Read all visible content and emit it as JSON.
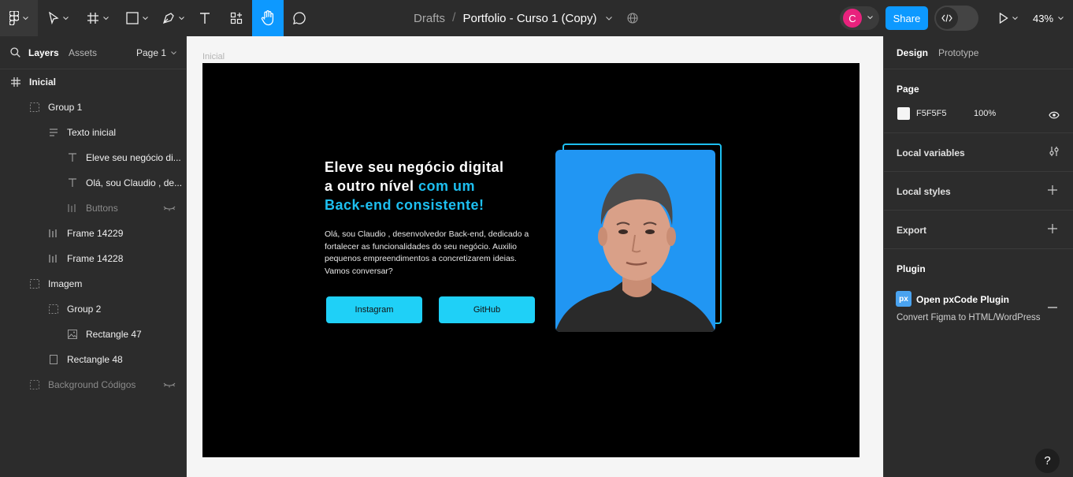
{
  "toolbar": {
    "breadcrumb_folder": "Drafts",
    "breadcrumb_separator": "/",
    "file_name": "Portfolio - Curso 1 (Copy)",
    "avatar_initial": "C",
    "avatar_color": "#e8227d",
    "share_label": "Share",
    "zoom_level": "43%",
    "accent_color": "#0d99ff"
  },
  "left_panel": {
    "tab_layers": "Layers",
    "tab_assets": "Assets",
    "page_selector": "Page 1",
    "layers": [
      {
        "label": "Inicial",
        "icon": "frame-icon",
        "level": 0
      },
      {
        "label": "Group 1",
        "icon": "group-icon",
        "level": 1
      },
      {
        "label": "Texto inicial",
        "icon": "auto-layout-vertical-icon",
        "level": 2
      },
      {
        "label": "Eleve seu negócio di...",
        "icon": "text-icon",
        "level": 3
      },
      {
        "label": "Olá, sou Claudio , de...",
        "icon": "text-icon",
        "level": 3
      },
      {
        "label": "Buttons",
        "icon": "auto-layout-horizontal-icon",
        "level": 3,
        "hidden": true
      },
      {
        "label": "Frame 14229",
        "icon": "auto-layout-horizontal-icon",
        "level": 2
      },
      {
        "label": "Frame 14228",
        "icon": "auto-layout-horizontal-icon",
        "level": 2
      },
      {
        "label": "Imagem",
        "icon": "group-icon",
        "level": 1
      },
      {
        "label": "Group 2",
        "icon": "group-icon",
        "level": 2
      },
      {
        "label": "Rectangle 47",
        "icon": "image-icon",
        "level": 3
      },
      {
        "label": "Rectangle 48",
        "icon": "rectangle-icon",
        "level": 2
      },
      {
        "label": "Background Códigos",
        "icon": "group-icon",
        "level": 1,
        "hidden": true
      }
    ]
  },
  "canvas": {
    "frame_label": "Inicial",
    "headline_line1": "Eleve seu negócio digital",
    "headline_line2_white": "a outro nível ",
    "headline_line2_accent": "com um",
    "headline_line3_accent": "Back-end consistente!",
    "paragraph": "Olá, sou Claudio , desenvolvedor Back-end, dedicado a fortalecer as funcionalidades do seu negócio. Auxilio pequenos empreendimentos a concretizarem ideias. Vamos conversar?",
    "button_instagram": "Instagram",
    "button_github": "GitHub",
    "accent_color": "#1dbff0",
    "button_color": "#1fd0f7",
    "photo_bg_color": "#2196f3"
  },
  "right_panel": {
    "tab_design": "Design",
    "tab_prototype": "Prototype",
    "page_title": "Page",
    "page_color": "F5F5F5",
    "page_opacity": "100%",
    "local_variables": "Local variables",
    "local_styles": "Local styles",
    "export": "Export",
    "plugin_title": "Plugin",
    "plugin_badge": "px",
    "plugin_name": "Open pxCode Plugin",
    "plugin_desc": "Convert Figma to HTML/WordPress"
  },
  "help_label": "?"
}
